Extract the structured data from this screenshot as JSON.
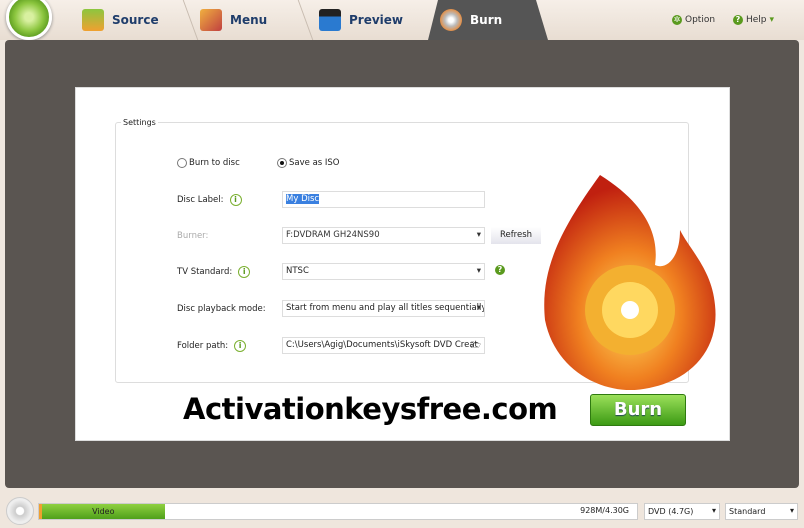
{
  "nav": {
    "steps": [
      {
        "label": "Source",
        "icon": "download-icon"
      },
      {
        "label": "Menu",
        "icon": "tools-icon"
      },
      {
        "label": "Preview",
        "icon": "clapper-icon"
      },
      {
        "label": "Burn",
        "icon": "burn-disc-icon",
        "active": true
      }
    ],
    "option": "Option",
    "help": "Help"
  },
  "settings": {
    "legend": "Settings",
    "burn_to_disc": "Burn to disc",
    "save_as_iso": "Save as ISO",
    "selected": "Save as ISO",
    "disc_label": "Disc Label:",
    "disc_label_value": "My Disc",
    "burner": "Burner:",
    "burner_value": "F:DVDRAM GH24NS90",
    "refresh": "Refresh",
    "tv_standard": "TV Standard:",
    "tv_standard_value": "NTSC",
    "playback_mode": "Disc playback mode:",
    "playback_mode_value": "Start from menu and play all titles sequentially",
    "folder_path": "Folder path:",
    "folder_path_value": "C:\\Users\\Agig\\Documents\\iSkysoft DVD Creat"
  },
  "burn_button": "Burn",
  "watermark": "Activationkeysfree.com",
  "footer": {
    "bar_label": "Video",
    "capacity": "928M/4.30G",
    "progress_percent": 21,
    "disc_type": "DVD (4.7G)",
    "quality": "Standard"
  },
  "colors": {
    "accent": "#5a9a1e",
    "main_bg": "#5a5551"
  }
}
